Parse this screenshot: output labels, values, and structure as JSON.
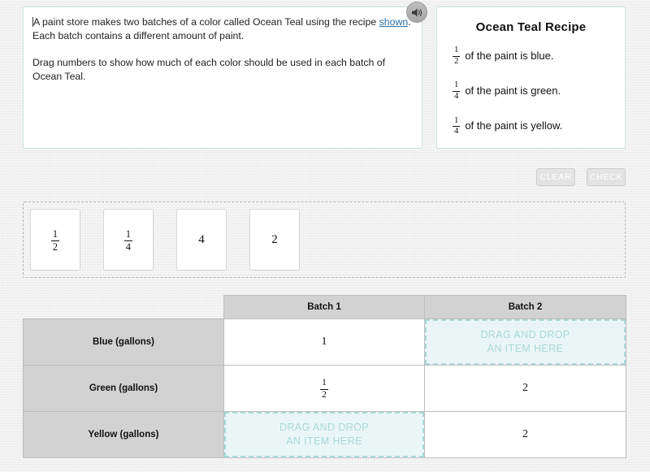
{
  "audio": {
    "icon": "speaker-icon"
  },
  "instruction": {
    "paragraph1_before_link": "A paint store makes two batches of a color called Ocean Teal using the recipe ",
    "link_text": "shown",
    "paragraph1_after_link": ". Each batch contains a different amount of paint.",
    "paragraph2": "Drag numbers to show how much of each color should be used in each batch of Ocean Teal."
  },
  "recipe": {
    "title": "Ocean Teal Recipe",
    "lines": [
      {
        "numerator": "1",
        "denominator": "2",
        "text": "of the paint is blue."
      },
      {
        "numerator": "1",
        "denominator": "4",
        "text": "of the paint is green."
      },
      {
        "numerator": "1",
        "denominator": "4",
        "text": "of the paint is yellow."
      }
    ]
  },
  "actions": {
    "clear_label": "CLEAR",
    "check_label": "CHECK"
  },
  "tile_bank": {
    "tiles": [
      {
        "type": "fraction",
        "numerator": "1",
        "denominator": "2",
        "label": "1/2"
      },
      {
        "type": "fraction",
        "numerator": "1",
        "denominator": "4",
        "label": "1/4"
      },
      {
        "type": "number",
        "label": "4"
      },
      {
        "type": "number",
        "label": "2"
      }
    ]
  },
  "table": {
    "headers": {
      "corner": "",
      "batch1": "Batch 1",
      "batch2": "Batch 2"
    },
    "dropzone_line1": "DRAG AND DROP",
    "dropzone_line2": "AN ITEM HERE",
    "rows": [
      {
        "label": "Blue (gallons)",
        "batch1": {
          "state": "filled",
          "type": "number",
          "label": "1"
        },
        "batch2": {
          "state": "empty",
          "type": "dropzone",
          "label": ""
        }
      },
      {
        "label": "Green (gallons)",
        "batch1": {
          "state": "filled",
          "type": "fraction",
          "numerator": "1",
          "denominator": "2",
          "label": "1/2"
        },
        "batch2": {
          "state": "filled",
          "type": "number",
          "label": "2"
        }
      },
      {
        "label": "Yellow (gallons)",
        "batch1": {
          "state": "empty",
          "type": "dropzone",
          "label": ""
        },
        "batch2": {
          "state": "filled",
          "type": "number",
          "label": "2"
        }
      }
    ]
  },
  "colors": {
    "page_background": "#ececed",
    "panel_border": "#cfe3e2",
    "dropzone_background": "#eaf6f5",
    "dropzone_border": "#a9d8d8",
    "dropzone_text": "#a9d8d8",
    "header_gray": "#d2d2d2",
    "link": "#2b6ea8"
  }
}
